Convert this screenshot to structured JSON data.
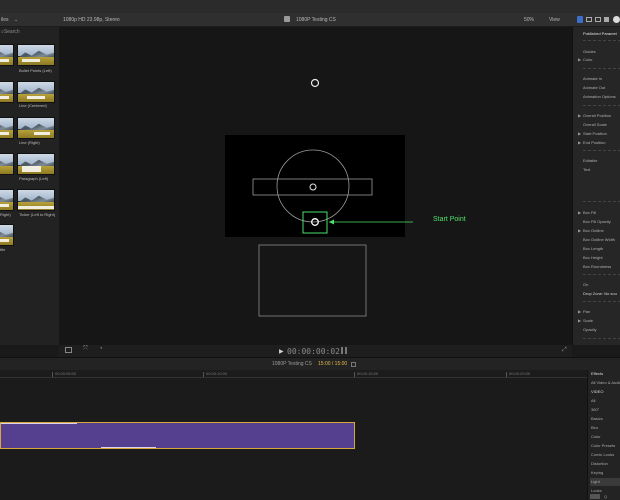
{
  "topbar": {
    "browser_menu": "iles",
    "format": "1080p HD 23.98p, Stereo",
    "project": "1080P Testing CS",
    "zoom": "50%",
    "view": "View"
  },
  "browser": {
    "search_placeholder": "Search",
    "thumbnails": [
      {
        "label": "",
        "col": 0
      },
      {
        "label": "Bullet Points (Left)",
        "col": 1
      },
      {
        "label": "Line (Centered)",
        "col": 1
      },
      {
        "label": "Line (Right)",
        "col": 1
      },
      {
        "label": "Paragraph (Left)",
        "col": 1
      },
      {
        "label": "Ticker (Left to Right)",
        "col": 1
      },
      {
        "label": "Right)",
        "col": 0
      },
      {
        "label": "ttle",
        "col": 0
      }
    ]
  },
  "viewer": {
    "callout_label": "Start Point",
    "timecode": "00:00:00:02",
    "colors": {
      "callout": "#4ee06a",
      "canvas": "#000000"
    }
  },
  "inspector": {
    "header": "Published Paramet",
    "items": [
      {
        "label": "Guides",
        "tri": false
      },
      {
        "label": "Color",
        "tri": true
      },
      {
        "label": "Animate In",
        "tri": false
      },
      {
        "label": "Animate Out",
        "tri": false
      },
      {
        "label": "Animation Options",
        "tri": false
      },
      {
        "label": "Overall Position",
        "tri": true
      },
      {
        "label": "Overall Scale",
        "tri": false
      },
      {
        "label": "Start Position",
        "tri": true
      },
      {
        "label": "End Position",
        "tri": true
      },
      {
        "label": "Editable",
        "tri": false
      },
      {
        "label": "Text",
        "tri": false
      },
      {
        "label": "Box Fill",
        "tri": true
      },
      {
        "label": "Box Fill Opacity",
        "tri": false
      },
      {
        "label": "Box Outline",
        "tri": true
      },
      {
        "label": "Box Outline Width",
        "tri": false
      },
      {
        "label": "Box Length",
        "tri": false
      },
      {
        "label": "Box Height",
        "tri": false
      },
      {
        "label": "Box Roundness",
        "tri": false
      },
      {
        "label": "On",
        "tri": false
      },
      {
        "label": "Drop Zone: No sou",
        "tri": false
      },
      {
        "label": "Pan",
        "tri": true
      },
      {
        "label": "Scale",
        "tri": true
      },
      {
        "label": "Opacity",
        "tri": false
      }
    ]
  },
  "timeline": {
    "project": "1080P Testing CS",
    "duration": "15:00 / 15:00",
    "ruler_labels": [
      "00:00:05:00",
      "00:00:10:00",
      "00:00:15:00",
      "00:00:20:00"
    ],
    "clip_color": "#54408f",
    "clip_border": "#d7a93c"
  },
  "effects": {
    "header": "Effects",
    "items": [
      "All Video & Audio",
      "VIDEO",
      "All",
      "360°",
      "Basics",
      "Blur",
      "Color",
      "Color Presets",
      "Comic Looks",
      "Distortion",
      "Keying",
      "Light",
      "Looks"
    ],
    "selected_index": 11,
    "search_placeholder": "Q"
  }
}
